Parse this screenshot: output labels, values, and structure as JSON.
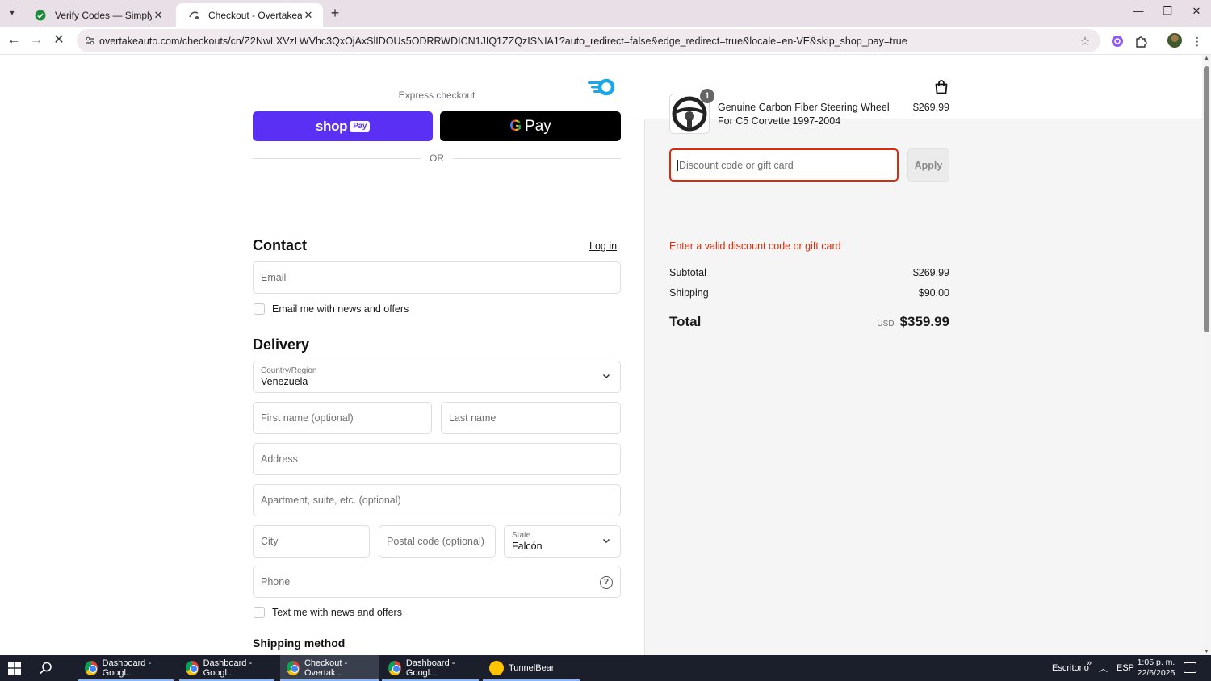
{
  "browser": {
    "tabs": [
      {
        "title": "Verify Codes — SimplyCodes",
        "active": false
      },
      {
        "title": "Checkout - Overtakeauto",
        "active": true
      }
    ],
    "url": "overtakeauto.com/checkouts/cn/Z2NwLXVzLWVhc3QxOjAxSlIDOUs5ODRRWDICN1JIQ1ZZQzISNIA1?auto_redirect=false&edge_redirect=true&locale=en-VE&skip_shop_pay=true"
  },
  "checkout": {
    "express_title": "Express checkout",
    "shop_pay_label": "shop",
    "shop_pay_badge": "Pay",
    "gpay_g": "G",
    "gpay_label": "Pay",
    "or_label": "OR",
    "contact": {
      "heading": "Contact",
      "login_label": "Log in",
      "email_placeholder": "Email",
      "newsletter_label": "Email me with news and offers"
    },
    "delivery": {
      "heading": "Delivery",
      "country_label": "Country/Region",
      "country_value": "Venezuela",
      "first_name_placeholder": "First name (optional)",
      "last_name_placeholder": "Last name",
      "address_placeholder": "Address",
      "apartment_placeholder": "Apartment, suite, etc. (optional)",
      "city_placeholder": "City",
      "postal_placeholder": "Postal code (optional)",
      "state_label": "State",
      "state_value": "Falcón",
      "phone_placeholder": "Phone",
      "help_glyph": "?",
      "sms_label": "Text me with news and offers"
    },
    "shipping_method_heading": "Shipping method"
  },
  "summary": {
    "product": {
      "name": "Genuine Carbon Fiber Steering Wheel For C5 Corvette 1997-2004",
      "price": "$269.99",
      "quantity": "1"
    },
    "discount_placeholder": "Discount code or gift card",
    "apply_label": "Apply",
    "error_message": "Enter a valid discount code or gift card",
    "subtotal_label": "Subtotal",
    "subtotal_value": "$269.99",
    "shipping_label": "Shipping",
    "shipping_value": "$90.00",
    "total_label": "Total",
    "currency": "USD",
    "total_value": "$359.99"
  },
  "taskbar": {
    "apps": [
      {
        "label": "Dashboard - Googl...",
        "icon": "chrome-icon",
        "active": false
      },
      {
        "label": "Dashboard - Googl...",
        "icon": "chrome-icon",
        "active": false
      },
      {
        "label": "Checkout - Overtak...",
        "icon": "chrome-icon",
        "active": true
      },
      {
        "label": "Dashboard - Googl...",
        "icon": "chrome-icon",
        "active": false
      },
      {
        "label": "TunnelBear",
        "icon": "tunnelbear-icon",
        "active": false
      }
    ],
    "desktop_label": "Escritorio",
    "overflow_glyph": "»",
    "language": "ESP",
    "time": "1:05 p. m.",
    "date": "22/6/2025"
  },
  "colors": {
    "shop_pay": "#5a31f4",
    "error": "#d82c0d",
    "gpay_bg": "#000000"
  }
}
